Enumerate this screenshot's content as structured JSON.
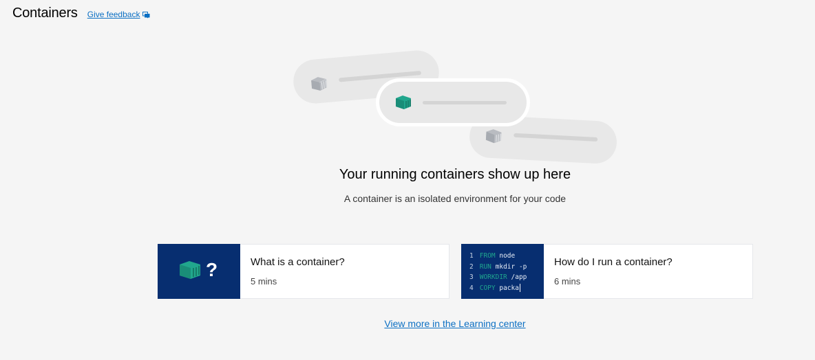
{
  "header": {
    "title": "Containers",
    "feedback_label": "Give feedback"
  },
  "illustration": {
    "pill_icon": "container-icon"
  },
  "empty_state": {
    "title": "Your running containers show up here",
    "subtitle": "A container is an isolated environment for your code"
  },
  "cards": [
    {
      "title": "What is a container?",
      "duration": "5 mins",
      "thumb_icon": "container-question-icon",
      "thumb_text": "?"
    },
    {
      "title": "How do I run a container?",
      "duration": "6 mins",
      "code": [
        {
          "num": "1",
          "kw": "FROM",
          "rest": " node"
        },
        {
          "num": "2",
          "kw": "RUN",
          "rest": " mkdir -p"
        },
        {
          "num": "3",
          "kw": "WORKDIR",
          "rest": " /app"
        },
        {
          "num": "4",
          "kw": "COPY",
          "rest": " packa"
        }
      ]
    }
  ],
  "learning_link": "View more in the Learning center",
  "colors": {
    "link": "#0b6fc3",
    "thumb_bg": "#072e70",
    "accent_teal": "#1fa58e",
    "page_bg": "#f5f5f5"
  }
}
